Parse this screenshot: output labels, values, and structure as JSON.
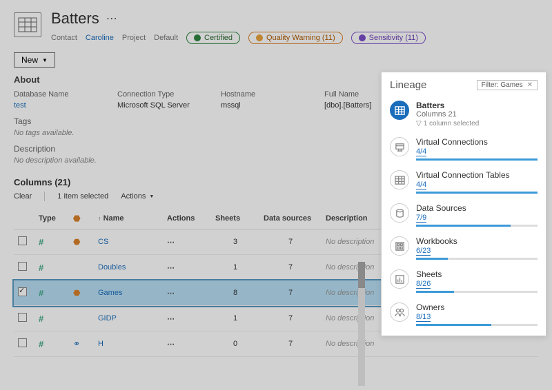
{
  "header": {
    "title": "Batters",
    "contact_label": "Contact",
    "contact_value": "Caroline",
    "project_label": "Project",
    "project_value": "Default",
    "badges": {
      "certified": "Certified",
      "warning": "Quality Warning (11)",
      "sensitivity": "Sensitivity (11)"
    },
    "new_button": "New"
  },
  "about": {
    "heading": "About",
    "db_label": "Database Name",
    "db_value": "test",
    "conn_label": "Connection Type",
    "conn_value": "Microsoft SQL Server",
    "host_label": "Hostname",
    "host_value": "mssql",
    "full_label": "Full Name",
    "full_value": "[dbo].[Batters]",
    "tags_label": "Tags",
    "tags_value": "No tags available.",
    "desc_label": "Description",
    "desc_value": "No description available."
  },
  "columns": {
    "heading": "Columns (21)",
    "clear": "Clear",
    "selected": "1 item selected",
    "actions": "Actions",
    "th_type": "Type",
    "th_name": "Name",
    "th_actions": "Actions",
    "th_sheets": "Sheets",
    "th_ds": "Data sources",
    "th_desc": "Description",
    "rows": [
      {
        "checked": false,
        "warn": true,
        "sens": false,
        "name": "CS",
        "sheets": "3",
        "ds": "7",
        "desc": "No description"
      },
      {
        "checked": false,
        "warn": false,
        "sens": false,
        "name": "Doubles",
        "sheets": "1",
        "ds": "7",
        "desc": "No description"
      },
      {
        "checked": true,
        "warn": true,
        "sens": false,
        "name": "Games",
        "sheets": "8",
        "ds": "7",
        "desc": "No description"
      },
      {
        "checked": false,
        "warn": false,
        "sens": false,
        "name": "GIDP",
        "sheets": "1",
        "ds": "7",
        "desc": "No description"
      },
      {
        "checked": false,
        "warn": false,
        "sens": true,
        "name": "H",
        "sheets": "0",
        "ds": "7",
        "desc": "No description"
      }
    ]
  },
  "lineage": {
    "title": "Lineage",
    "filter_label": "Filter: Games",
    "root": {
      "name": "Batters",
      "sub": "Columns 21",
      "note": "1 column selected"
    },
    "items": [
      {
        "label": "Virtual Connections",
        "count": "4/4",
        "fill": 100
      },
      {
        "label": "Virtual Connection Tables",
        "count": "4/4",
        "fill": 100
      },
      {
        "label": "Data Sources",
        "count": "7/9",
        "fill": 78
      },
      {
        "label": "Workbooks",
        "count": "6/23",
        "fill": 26
      },
      {
        "label": "Sheets",
        "count": "8/26",
        "fill": 31
      },
      {
        "label": "Owners",
        "count": "8/13",
        "fill": 62
      }
    ]
  }
}
